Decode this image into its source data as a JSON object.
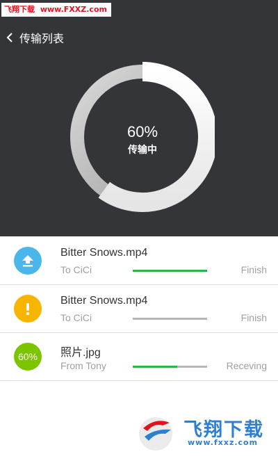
{
  "watermark": {
    "label": "飞翔下载",
    "url": "www.FXXZ.com"
  },
  "header": {
    "title": "传输列表",
    "back_icon": "chevron-left-icon"
  },
  "progress": {
    "percent_text": "60%",
    "status_text": "传输中",
    "fraction": 0.6
  },
  "transfers": [
    {
      "name": "Bitter Snows.mp4",
      "peer": "To CiCi",
      "status": "Finish",
      "progress": 1.0,
      "icon": "upload-icon",
      "icon_color": "#4bb6ea",
      "bar_color": "#2ab54a"
    },
    {
      "name": "Bitter Snows.mp4",
      "peer": "To CiCi",
      "status": "Finish",
      "progress": 0.0,
      "icon": "alert-icon",
      "icon_color": "#f7b500",
      "bar_color": "#2ab54a"
    },
    {
      "name": "照片.jpg",
      "peer": "From Tony",
      "status": "Receving",
      "progress": 0.6,
      "icon_text": "60%",
      "icon_color": "#7cc400",
      "bar_color": "#2ab54a"
    }
  ],
  "watermark_bottom": {
    "brand": "飞翔下载",
    "site": "www.fxxz.com"
  },
  "colors": {
    "header_bg": "#343538",
    "accent_green": "#2ab54a"
  }
}
